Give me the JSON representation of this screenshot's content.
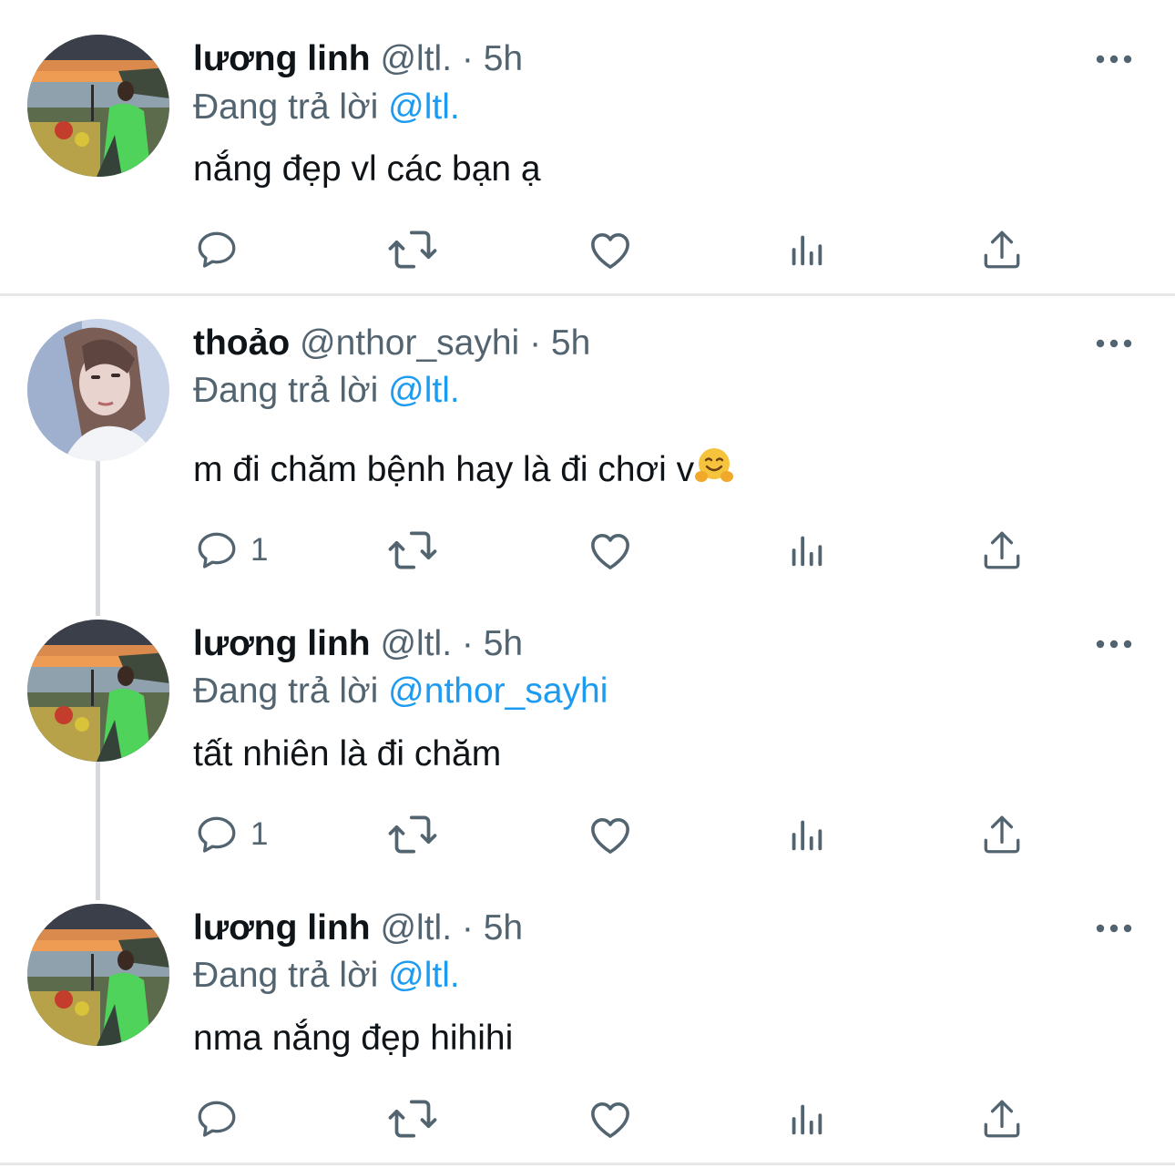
{
  "tweets": [
    {
      "name": "lương linh",
      "handle": "@ltl.",
      "dot": "·",
      "time": "5h",
      "reply_prefix": "Đang trả lời",
      "reply_to": "@ltl.",
      "text": "nắng đẹp vl các bạn ạ",
      "reply_count": ""
    },
    {
      "name": "thoảo",
      "handle": "@nthor_sayhi",
      "dot": "·",
      "time": "5h",
      "reply_prefix": "Đang trả lời",
      "reply_to": "@ltl.",
      "text": "m đi chăm bệnh hay là đi chơi v",
      "emoji": "hugging-face",
      "reply_count": "1"
    },
    {
      "name": "lương linh",
      "handle": "@ltl.",
      "dot": "·",
      "time": "5h",
      "reply_prefix": "Đang trả lời",
      "reply_to": "@nthor_sayhi",
      "text": "tất nhiên là đi chăm",
      "reply_count": "1"
    },
    {
      "name": "lương linh",
      "handle": "@ltl.",
      "dot": "·",
      "time": "5h",
      "reply_prefix": "Đang trả lời",
      "reply_to": "@ltl.",
      "text": "nma nắng đẹp hihihi",
      "reply_count": ""
    }
  ],
  "icons": [
    "reply-icon",
    "retweet-icon",
    "like-icon",
    "views-icon",
    "share-icon",
    "more-icon"
  ],
  "colors": {
    "mention": "#1d9bf0",
    "muted": "#536471",
    "text": "#0f1419",
    "icon": "#536471"
  }
}
